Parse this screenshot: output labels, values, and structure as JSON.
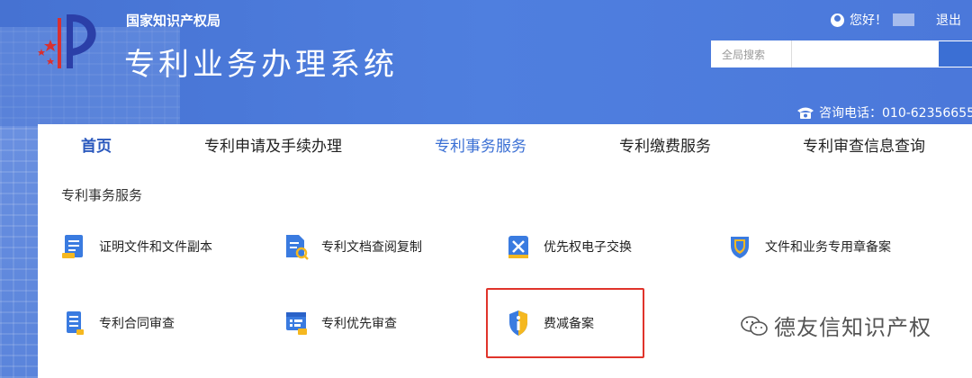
{
  "header": {
    "org_name": "国家知识产权局",
    "system_title": "专利业务办理系统",
    "greeting": "您好！",
    "logout_label": "退出",
    "search_label": "全局搜索",
    "search_value": "",
    "hotline": "咨询电话：010-62356655"
  },
  "nav": {
    "items": [
      {
        "label": "首页"
      },
      {
        "label": "专利申请及手续办理"
      },
      {
        "label": "专利事务服务"
      },
      {
        "label": "专利缴费服务"
      },
      {
        "label": "专利审查信息查询"
      }
    ],
    "active": "专利事务服务"
  },
  "main": {
    "section_title": "专利事务服务",
    "services": [
      {
        "label": "证明文件和文件副本",
        "icon": "certificate-document-icon"
      },
      {
        "label": "专利文档查阅复制",
        "icon": "document-search-icon"
      },
      {
        "label": "优先权电子交换",
        "icon": "exchange-icon"
      },
      {
        "label": "文件和业务专用章备案",
        "icon": "shield-seal-icon"
      },
      {
        "label": "专利合同审查",
        "icon": "contract-document-icon"
      },
      {
        "label": "专利优先审查",
        "icon": "priority-review-icon"
      },
      {
        "label": "费减备案",
        "icon": "fee-reduction-shield-icon"
      }
    ]
  },
  "watermark": "德友信知识产权",
  "colors": {
    "header_blue": "#4a78d6",
    "nav_active": "#3a6fd4",
    "highlight_red": "#e0342b"
  }
}
